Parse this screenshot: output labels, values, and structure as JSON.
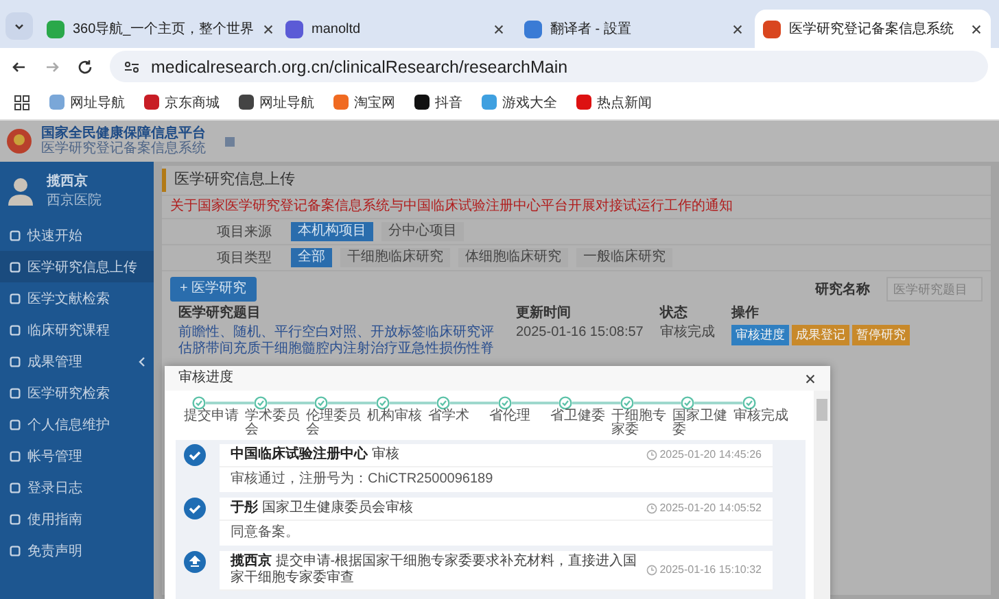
{
  "browser": {
    "tabs": [
      {
        "title": "360导航_一个主页，整个世界",
        "selected": false
      },
      {
        "title": "manoltd",
        "selected": false
      },
      {
        "title": "翻译者 - 設置",
        "selected": false
      },
      {
        "title": "医学研究登记备案信息系统",
        "selected": true
      }
    ],
    "url": "medicalresearch.org.cn/clinicalResearch/researchMain",
    "bookmarks": [
      "网址导航",
      "京东商城",
      "网址导航",
      "淘宝网",
      "抖音",
      "游戏大全",
      "热点新闻"
    ]
  },
  "header": {
    "platform": "国家全民健康保障信息平台",
    "system": "医学研究登记备案信息系统"
  },
  "sidebar": {
    "user": {
      "name": "揽西京",
      "org": "西京医院"
    },
    "items": [
      {
        "label": "快速开始",
        "selected": false
      },
      {
        "label": "医学研究信息上传",
        "selected": true
      },
      {
        "label": "医学文献检索",
        "selected": false
      },
      {
        "label": "临床研究课程",
        "selected": false
      },
      {
        "label": "成果管理",
        "selected": false,
        "submenu": true
      },
      {
        "label": "医学研究检索",
        "selected": false
      },
      {
        "label": "个人信息维护",
        "selected": false
      },
      {
        "label": "帐号管理",
        "selected": false
      },
      {
        "label": "登录日志",
        "selected": false
      },
      {
        "label": "使用指南",
        "selected": false
      },
      {
        "label": "免责声明",
        "selected": false
      }
    ]
  },
  "main": {
    "title": "医学研究信息上传",
    "notice": "关于国家医学研究登记备案信息系统与中国临床试验注册中心平台开展对接试运行工作的通知",
    "filters": [
      {
        "label": "项目来源",
        "options": [
          {
            "label": "本机构项目",
            "selected": true
          },
          {
            "label": "分中心项目",
            "selected": false
          }
        ]
      },
      {
        "label": "项目类型",
        "options": [
          {
            "label": "全部",
            "selected": true
          },
          {
            "label": "干细胞临床研究",
            "selected": false
          },
          {
            "label": "体细胞临床研究",
            "selected": false
          },
          {
            "label": "一般临床研究",
            "selected": false
          }
        ]
      }
    ],
    "add_button": "+ 医学研究",
    "search": {
      "label": "研究名称",
      "placeholder": "医学研究题目"
    },
    "table": {
      "columns": [
        "医学研究题目",
        "更新时间",
        "状态",
        "操作"
      ],
      "rows": [
        {
          "title": "前瞻性、随机、平行空白对照、开放标签临床研究评估脐带间充质干细胞髓腔内注射治疗亚急性损伤性脊",
          "updated": "2025-01-16 15:08:57",
          "status": "审核完成",
          "actions": [
            {
              "label": "审核进度",
              "color": "#2f7fc1"
            },
            {
              "label": "成果登记",
              "color": "#c8892a"
            },
            {
              "label": "暂停研究",
              "color": "#c8892a"
            }
          ]
        }
      ]
    }
  },
  "modal": {
    "title": "审核进度",
    "steps": [
      {
        "label": "提交申请",
        "done": true
      },
      {
        "label": "学术委员会",
        "done": true
      },
      {
        "label": "伦理委员会",
        "done": true
      },
      {
        "label": "机构审核",
        "done": true
      },
      {
        "label": "省学术",
        "done": true
      },
      {
        "label": "省伦理",
        "done": true
      },
      {
        "label": "省卫健委",
        "done": true
      },
      {
        "label": "干细胞专家委",
        "done": true
      },
      {
        "label": "国家卫健委",
        "done": true
      },
      {
        "label": "审核完成",
        "done": true
      }
    ],
    "events": [
      {
        "kind": "approved",
        "actor": "中国临床试验注册中心",
        "action": "审核",
        "time": "2025-01-20 14:45:26",
        "comment": "审核通过，注册号为：ChiCTR2500096189"
      },
      {
        "kind": "approved",
        "actor": "于彤",
        "action": "国家卫生健康委员会审核",
        "time": "2025-01-20 14:05:52",
        "comment": "同意备案。"
      },
      {
        "kind": "submitted",
        "actor": "揽西京",
        "action": "提交申请-根据国家干细胞专家委要求补充材料，直接进入国家干细胞专家委审查",
        "time": "2025-01-16 15:10:32"
      }
    ]
  }
}
